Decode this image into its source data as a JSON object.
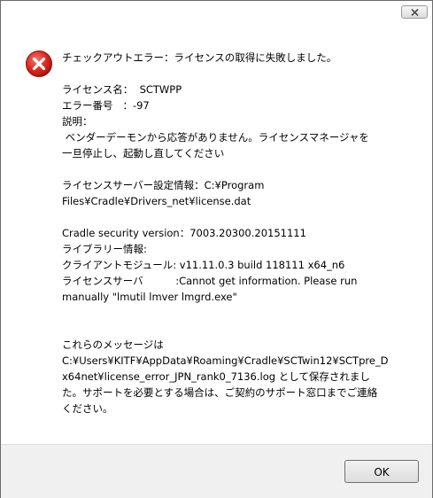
{
  "dialog": {
    "close_label": "×",
    "message_lines": [
      "チェックアウトエラー：ライセンスの取得に失敗しました。",
      "",
      "ライセンス名：  SCTWPP",
      "エラー番号   ：-97",
      "説明：",
      " ベンダーデーモンから応答がありません。ライセンスマネージャを",
      "一旦停止し、起動し直してください",
      "",
      "ライセンスサーバー設定情報：C:¥Program",
      "Files¥Cradle¥Drivers_net¥license.dat",
      "",
      "Cradle security version：7003.20300.20151111",
      "ライブラリー情報:",
      "クライアントモジュール: v11.11.0.3 build 118111 x64_n6",
      "ライセンスサーバ          :Cannot get information. Please run",
      "manually \"lmutil lmver lmgrd.exe\"",
      "",
      "",
      "これらのメッセージは",
      "C:¥Users¥KITF¥AppData¥Roaming¥Cradle¥SCTwin12¥SCTpre_D",
      "x64net¥license_error_JPN_rank0_7136.log として保存されまし",
      "た。サポートを必要とする場合は、ご契約のサポート窓口までご連絡",
      "ください。"
    ],
    "ok_label": "OK"
  },
  "colors": {
    "error_red": "#d9261c",
    "footer_bg": "#f0f0f0"
  },
  "icons": {
    "error": "error-icon",
    "close": "close-icon"
  }
}
